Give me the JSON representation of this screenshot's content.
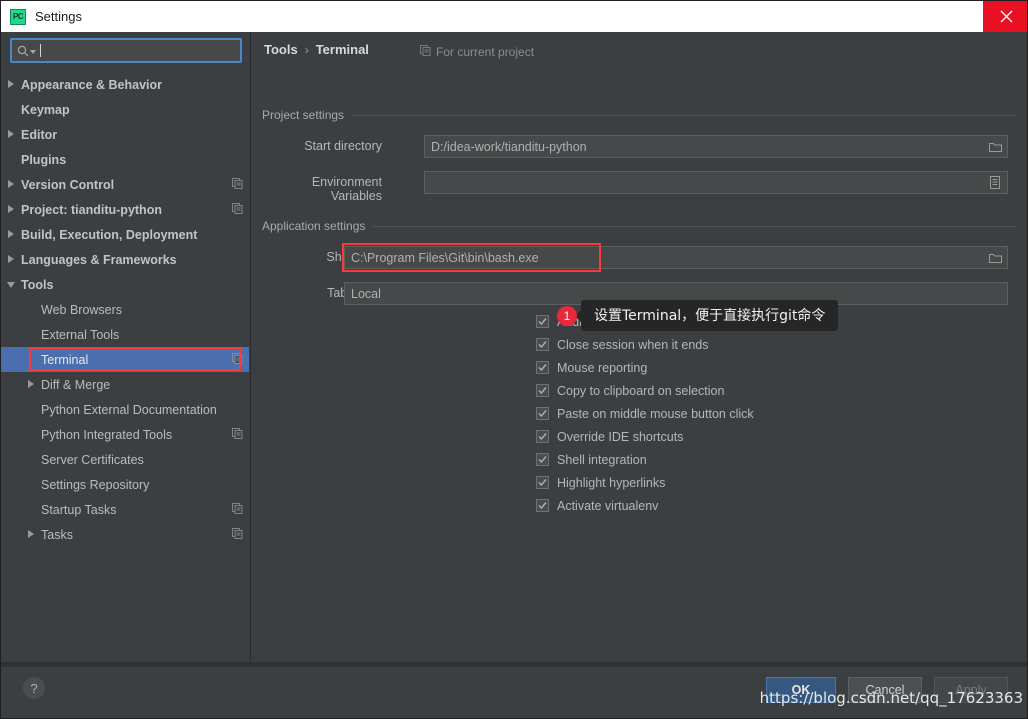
{
  "window": {
    "title": "Settings",
    "app_icon": "pycharm-icon",
    "icon_text": "PC",
    "close_icon": "close-icon",
    "accent_blue": "#4b6eaf",
    "annotation_red": "#fb3b3b",
    "close_red": "#e81123"
  },
  "search": {
    "value": "",
    "placeholder": "",
    "icon": "search-icon"
  },
  "sidebar": {
    "items": [
      {
        "label": "Appearance & Behavior",
        "level": 0,
        "arrow": "right",
        "scope_icon": false,
        "selected": false
      },
      {
        "label": "Keymap",
        "level": 0,
        "arrow": "none",
        "scope_icon": false,
        "selected": false
      },
      {
        "label": "Editor",
        "level": 0,
        "arrow": "right",
        "scope_icon": false,
        "selected": false
      },
      {
        "label": "Plugins",
        "level": 0,
        "arrow": "none",
        "scope_icon": false,
        "selected": false
      },
      {
        "label": "Version Control",
        "level": 0,
        "arrow": "right",
        "scope_icon": true,
        "selected": false
      },
      {
        "label": "Project: tianditu-python",
        "level": 0,
        "arrow": "right",
        "scope_icon": true,
        "selected": false
      },
      {
        "label": "Build, Execution, Deployment",
        "level": 0,
        "arrow": "right",
        "scope_icon": false,
        "selected": false
      },
      {
        "label": "Languages & Frameworks",
        "level": 0,
        "arrow": "right",
        "scope_icon": false,
        "selected": false
      },
      {
        "label": "Tools",
        "level": 0,
        "arrow": "down",
        "scope_icon": false,
        "selected": false
      },
      {
        "label": "Web Browsers",
        "level": 1,
        "arrow": "none",
        "scope_icon": false,
        "selected": false
      },
      {
        "label": "External Tools",
        "level": 1,
        "arrow": "none",
        "scope_icon": false,
        "selected": false
      },
      {
        "label": "Terminal",
        "level": 1,
        "arrow": "none",
        "scope_icon": true,
        "selected": true
      },
      {
        "label": "Diff & Merge",
        "level": 1,
        "arrow": "right",
        "scope_icon": false,
        "selected": false
      },
      {
        "label": "Python External Documentation",
        "level": 1,
        "arrow": "none",
        "scope_icon": false,
        "selected": false
      },
      {
        "label": "Python Integrated Tools",
        "level": 1,
        "arrow": "none",
        "scope_icon": true,
        "selected": false
      },
      {
        "label": "Server Certificates",
        "level": 1,
        "arrow": "none",
        "scope_icon": false,
        "selected": false
      },
      {
        "label": "Settings Repository",
        "level": 1,
        "arrow": "none",
        "scope_icon": false,
        "selected": false
      },
      {
        "label": "Startup Tasks",
        "level": 1,
        "arrow": "none",
        "scope_icon": true,
        "selected": false
      },
      {
        "label": "Tasks",
        "level": 1,
        "arrow": "right",
        "scope_icon": true,
        "selected": false
      }
    ]
  },
  "content": {
    "breadcrumb_root": "Tools",
    "breadcrumb_sep": "›",
    "breadcrumb_leaf": "Terminal",
    "for_current_project": "For current project",
    "project_section": "Project settings",
    "application_section": "Application settings",
    "fields": [
      {
        "label": "Start directory",
        "value": "D:/idea-work/tianditu-python",
        "button_icon": "folder-icon"
      },
      {
        "label": "Environment Variables",
        "value": "",
        "button_icon": "list-icon"
      },
      {
        "label": "Shell path",
        "value": "C:\\Program Files\\Git\\bin\\bash.exe",
        "button_icon": "folder-icon"
      },
      {
        "label": "Tab name",
        "value": "Local",
        "button_icon": "none"
      }
    ],
    "checkboxes": [
      {
        "label": "Audible bell",
        "checked": true
      },
      {
        "label": "Close session when it ends",
        "checked": true
      },
      {
        "label": "Mouse reporting",
        "checked": true
      },
      {
        "label": "Copy to clipboard on selection",
        "checked": true
      },
      {
        "label": "Paste on middle mouse button click",
        "checked": true
      },
      {
        "label": "Override IDE shortcuts",
        "checked": true
      },
      {
        "label": "Shell integration",
        "checked": true
      },
      {
        "label": "Highlight hyperlinks",
        "checked": true
      },
      {
        "label": "Activate virtualenv",
        "checked": true
      }
    ]
  },
  "annotation": {
    "number": "1",
    "text": "设置Terminal，便于直接执行git命令"
  },
  "footer": {
    "help": "?",
    "ok": "OK",
    "cancel": "Cancel",
    "apply": "Apply",
    "watermark": "https://blog.csdn.net/qq_17623363"
  }
}
